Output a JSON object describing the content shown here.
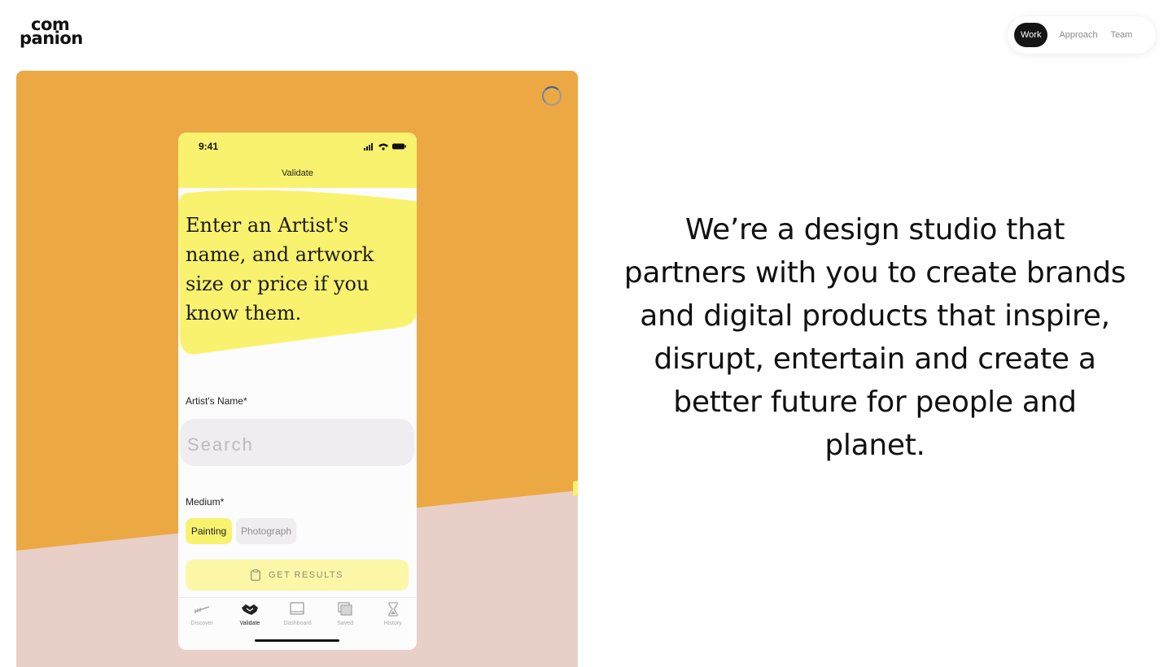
{
  "brand": {
    "logo_line1": "com",
    "logo_line2": "panion"
  },
  "nav": {
    "items": [
      "Work",
      "Approach",
      "Team"
    ],
    "active": "Work"
  },
  "colors": {
    "hero_orange": "#eca843",
    "hero_pink": "#e8cfc8",
    "app_yellow": "#f9f26e",
    "nav_active": "#151515"
  },
  "phone": {
    "time": "9:41",
    "screen_title": "Validate",
    "prompt": "Enter an Artist's name, and artwork size or price if you know them.",
    "artist_label": "Artist's Name*",
    "search_placeholder": "Search",
    "medium_label": "Medium*",
    "medium_options": [
      "Painting",
      "Photograph"
    ],
    "medium_selected": "Painting",
    "results_button": "GET RESULTS",
    "tabs": [
      {
        "label": "Discover",
        "icon": "discover-icon"
      },
      {
        "label": "Validate",
        "icon": "handshake-icon"
      },
      {
        "label": "Dashboard",
        "icon": "dashboard-icon"
      },
      {
        "label": "Saved",
        "icon": "saved-icon"
      },
      {
        "label": "History",
        "icon": "hourglass-icon"
      }
    ],
    "active_tab": "Validate"
  },
  "headline": "We’re a design studio that partners with you to create brands and digital products that inspire, disrupt, entertain and create a better future for people and planet."
}
